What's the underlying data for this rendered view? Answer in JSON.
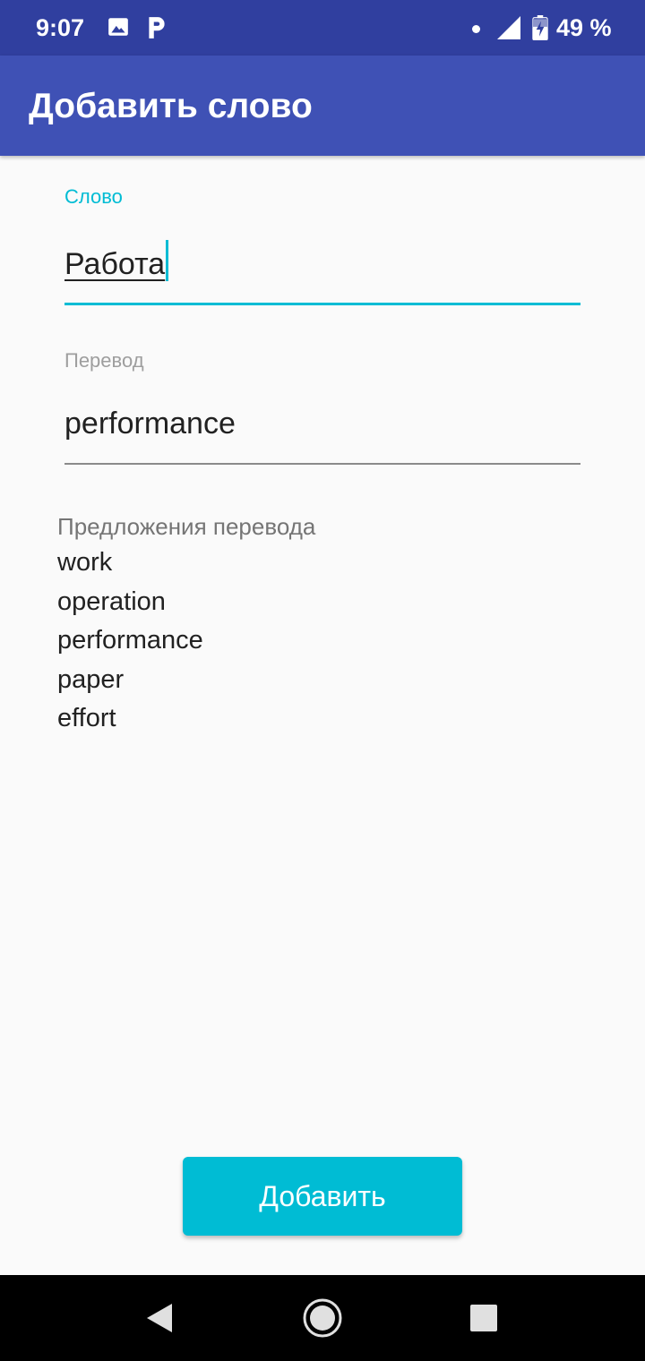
{
  "status_bar": {
    "time": "9:07",
    "battery_text": "49 %",
    "icons": [
      "image-icon",
      "parking-icon",
      "notification-dot-icon",
      "signal-icon",
      "battery-charging-icon"
    ]
  },
  "app_bar": {
    "title": "Добавить слово"
  },
  "form": {
    "word_label": "Слово",
    "word_value": "Работа",
    "translation_label": "Перевод",
    "translation_value": "performance"
  },
  "suggestions": {
    "header": "Предложения перевода",
    "items": [
      "work",
      "operation",
      "performance",
      "paper",
      "effort"
    ]
  },
  "actions": {
    "add_label": "Добавить"
  },
  "navigation": {
    "buttons": [
      "back-icon",
      "home-icon",
      "recents-icon"
    ]
  },
  "colors": {
    "status_bar": "#303f9f",
    "app_bar": "#3f51b5",
    "accent": "#00bcd4",
    "background": "#fafafa"
  }
}
